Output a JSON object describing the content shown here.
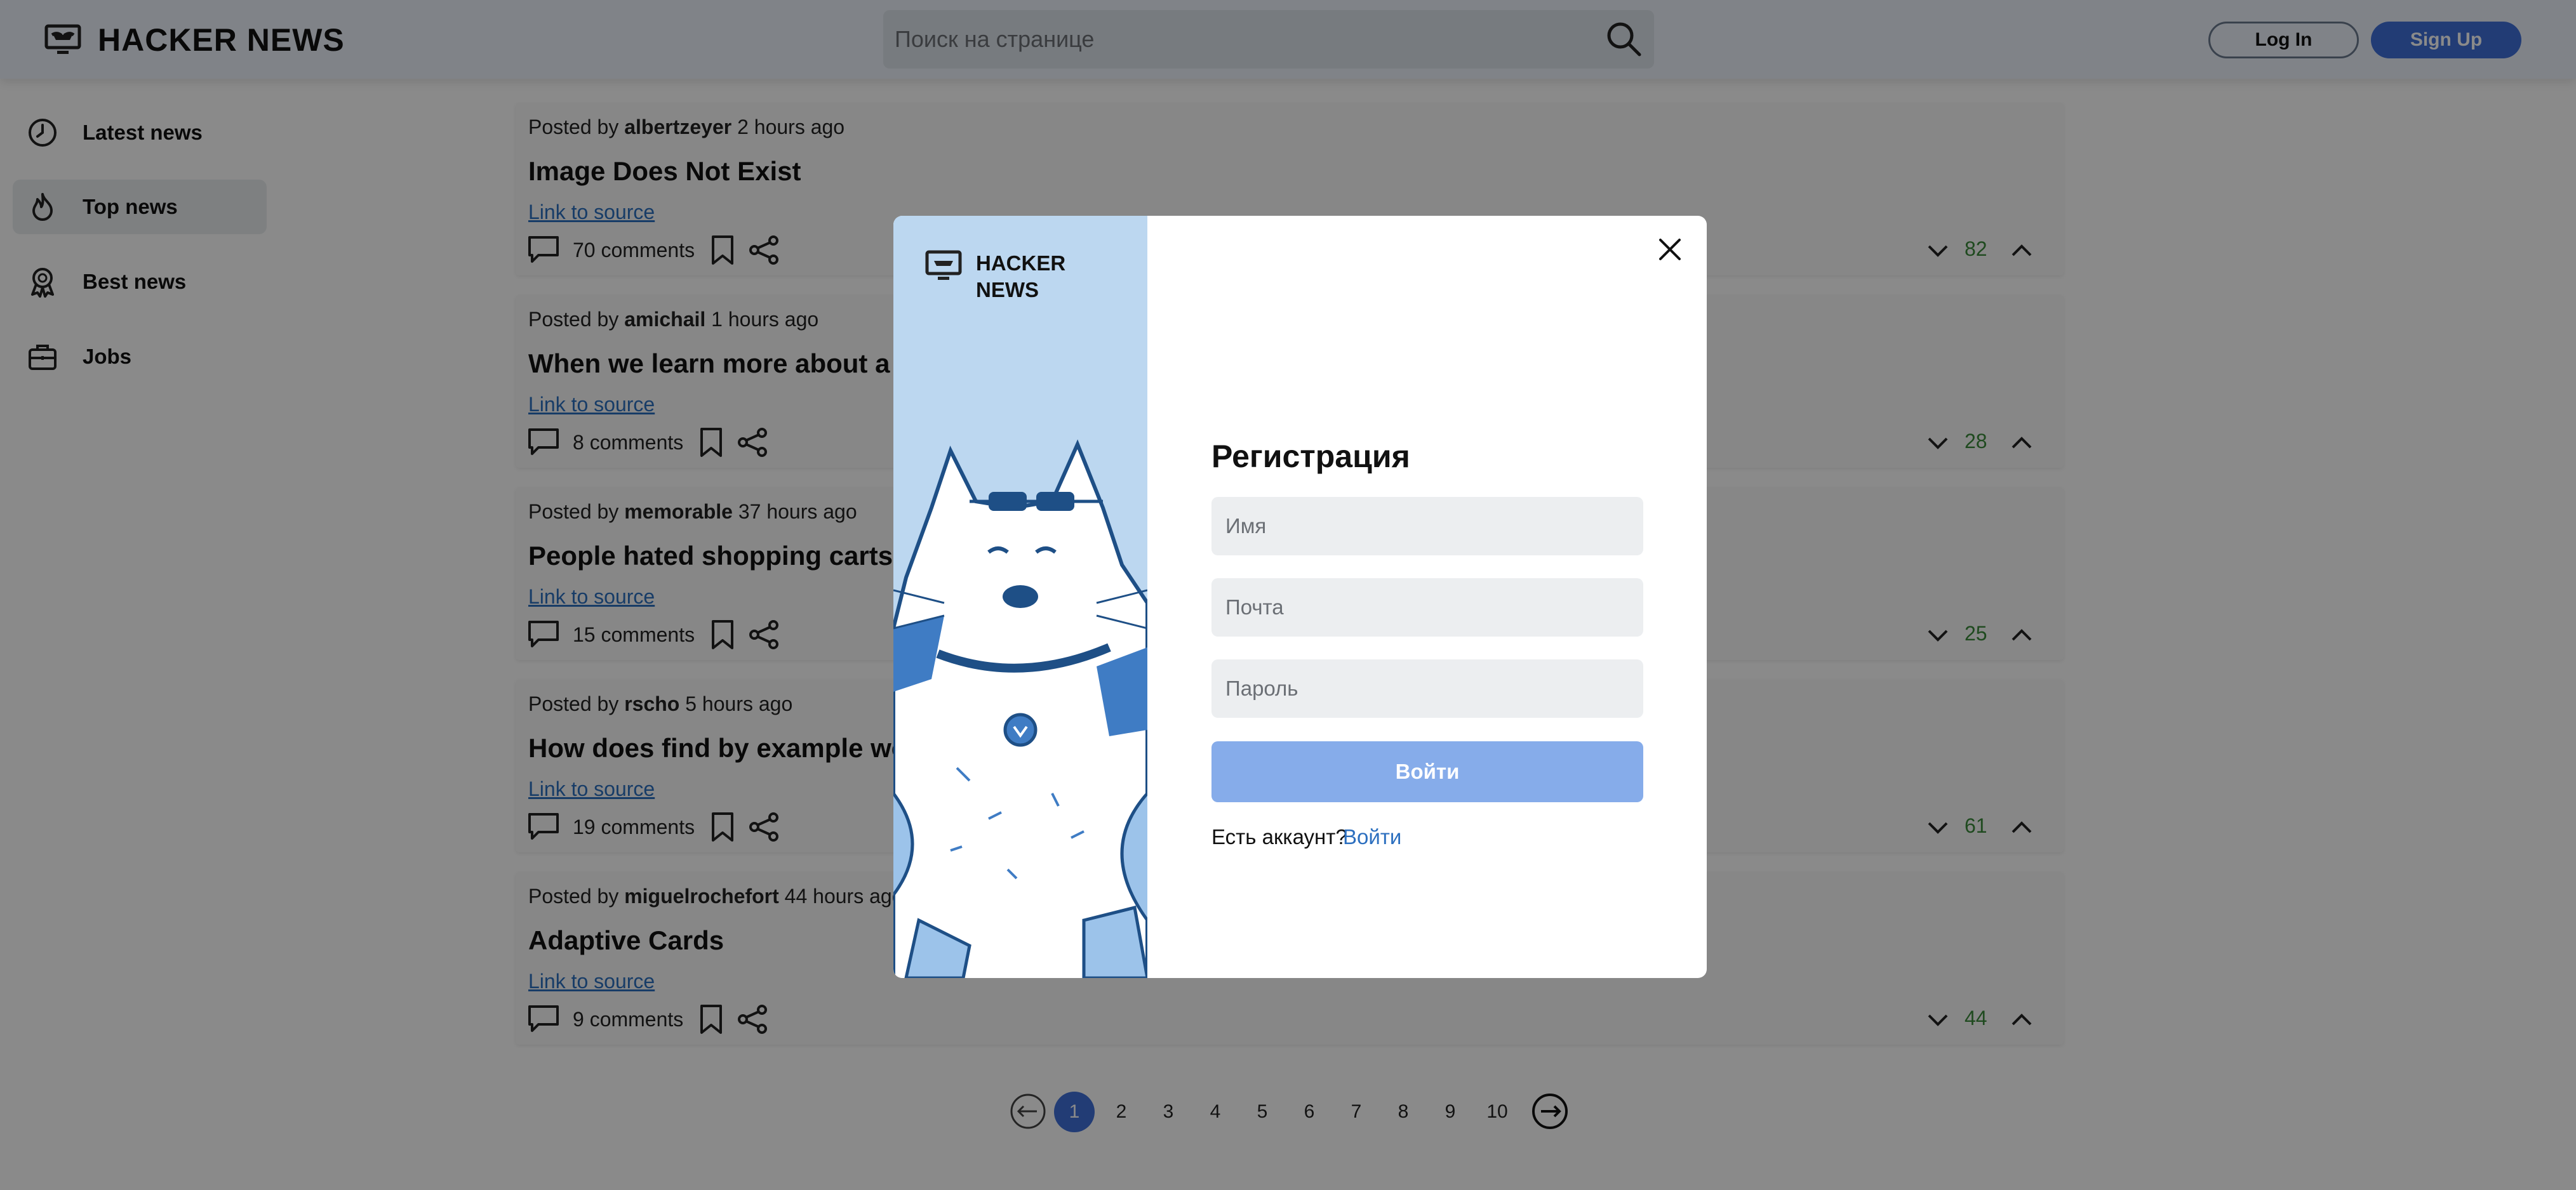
{
  "header": {
    "brand": "HACKER NEWS",
    "search_placeholder": "Поиск на странице",
    "login_label": "Log In",
    "signup_label": "Sign Up"
  },
  "sidebar": {
    "items": [
      {
        "label": "Latest news",
        "icon": "clock-icon",
        "active": false
      },
      {
        "label": "Top news",
        "icon": "flame-icon",
        "active": true
      },
      {
        "label": "Best news",
        "icon": "award-icon",
        "active": false
      },
      {
        "label": "Jobs",
        "icon": "briefcase-icon",
        "active": false
      }
    ]
  },
  "posts": [
    {
      "posted_by": "Posted by",
      "author": "albertzeyer",
      "time": "2 hours ago",
      "title": "Image Does Not Exist",
      "link": "Link to source",
      "comments": "70 comments",
      "votes": "82"
    },
    {
      "posted_by": "Posted by",
      "author": "amichail",
      "time": "1 hours ago",
      "title": "When we learn more about a s",
      "link": "Link to source",
      "comments": "8 comments",
      "votes": "28"
    },
    {
      "posted_by": "Posted by",
      "author": "memorable",
      "time": "37 hours ago",
      "title": "People hated shopping carts w",
      "link": "Link to source",
      "comments": "15 comments",
      "votes": "25"
    },
    {
      "posted_by": "Posted by",
      "author": "rscho",
      "time": "5 hours ago",
      "title": "How does find by example wo",
      "link": "Link to source",
      "comments": "19 comments",
      "votes": "61"
    },
    {
      "posted_by": "Posted by",
      "author": "miguelrochefort",
      "time": "44 hours ago",
      "title": "Adaptive Cards",
      "link": "Link to source",
      "comments": "9 comments",
      "votes": "44"
    }
  ],
  "pagination": {
    "pages": [
      "1",
      "2",
      "3",
      "4",
      "5",
      "6",
      "7",
      "8",
      "9",
      "10"
    ],
    "current": "1"
  },
  "modal": {
    "brand_line1": "HACKER",
    "brand_line2": "NEWS",
    "title": "Регистрация",
    "name_placeholder": "Имя",
    "email_placeholder": "Почта",
    "password_placeholder": "Пароль",
    "submit_label": "Войти",
    "have_account": "Есть аккаунт?",
    "login_link": "Войти"
  },
  "colors": {
    "accent": "#3f6fd8",
    "submit": "#86acea",
    "modal_side": "#bcd7f0",
    "vote": "#3a8a3a",
    "link": "#2c6fbf"
  }
}
